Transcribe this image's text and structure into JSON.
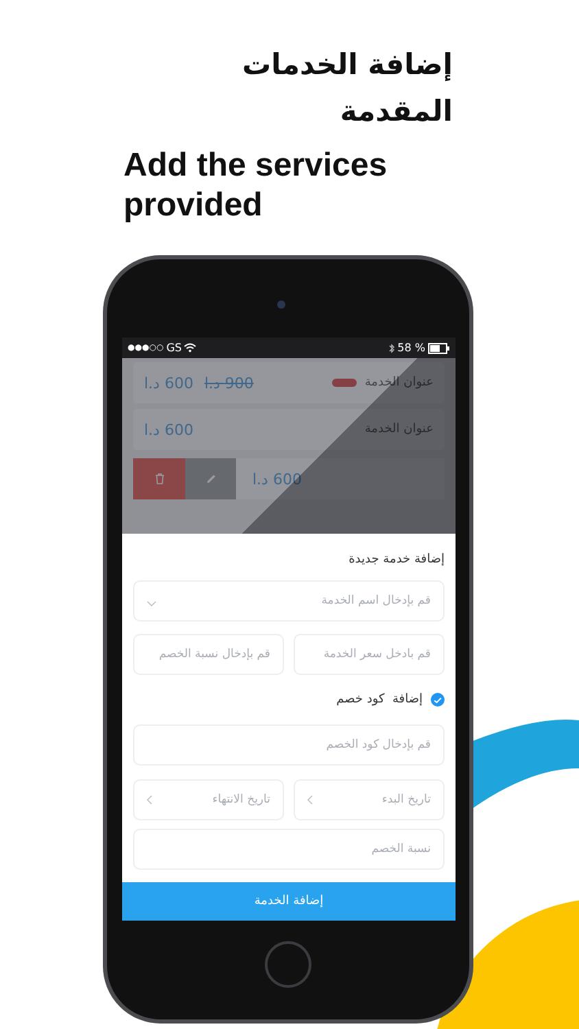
{
  "headline": {
    "arabic": "إضافة الخدمات المقدمة",
    "english": "Add the services provided"
  },
  "status_bar": {
    "signal": "●●●○○",
    "carrier": "GS",
    "battery": "58 %"
  },
  "services": [
    {
      "kind": "discounted",
      "title": "عنوان الخدمة",
      "price": "600 د.ا",
      "old_price": "900 د.ا"
    },
    {
      "kind": "plain",
      "title": "عنوان الخدمة",
      "price": "600 د.ا"
    },
    {
      "kind": "swiped",
      "price": "600 د.ا"
    }
  ],
  "form": {
    "title": "إضافة خدمة جديدة",
    "service_name": {
      "placeholder": "قم بإدخال اسم الخدمة"
    },
    "price": {
      "placeholder": "قم بادخل سعر الخدمة"
    },
    "discount_rate": {
      "placeholder": "قم بإدخال نسبة الخصم"
    },
    "coupon_toggle": {
      "label": "إضافة  كود خصم",
      "checked": true
    },
    "coupon_code": {
      "placeholder": "قم بإدخال كود الخصم"
    },
    "start_date": {
      "placeholder": "تاريخ البدء"
    },
    "end_date": {
      "placeholder": "تاريخ الانتهاء"
    },
    "coupon_discount": {
      "placeholder": "نسبة الخصم"
    },
    "submit": "إضافة الخدمة"
  }
}
